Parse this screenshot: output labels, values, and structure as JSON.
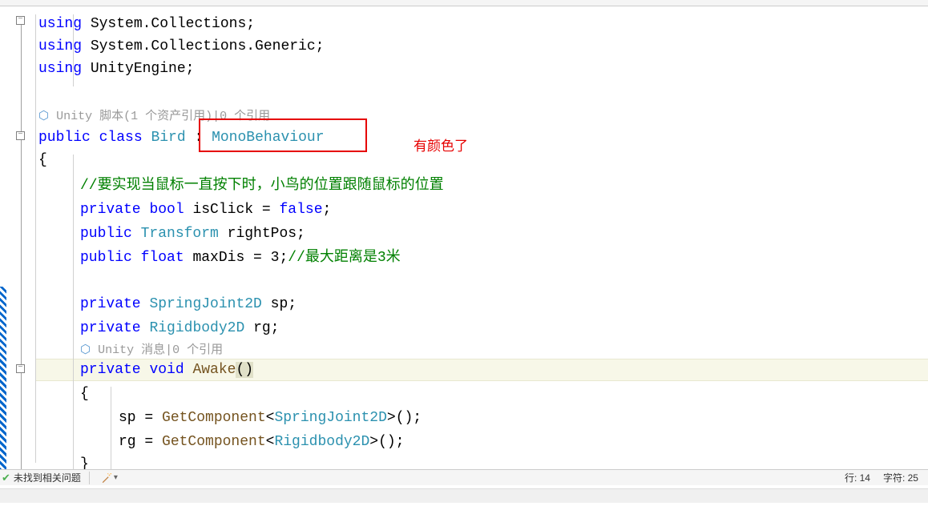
{
  "code": {
    "line1": "using",
    "line1_ns": " System.Collections;",
    "line2": "using",
    "line2_ns": " System.Collections.Generic;",
    "line3": "using",
    "line3_ns": " UnityEngine;",
    "codelens1": " Unity 脚本(1 个资产引用)|0 个引用",
    "line5_kw1": "public",
    "line5_kw2": "class",
    "line5_cls": "Bird",
    "line5_colon": " : ",
    "line5_base": "MonoBehaviour",
    "brace_open": "{",
    "comment1": "//要实现当鼠标一直按下时，小鸟的位置跟随鼠标的位置",
    "line8_kw": "private",
    "line8_type": "bool",
    "line8_rest": " isClick = ",
    "line8_false": "false",
    "line8_semi": ";",
    "line9_kw": "public",
    "line9_type": "Transform",
    "line9_rest": " rightPos;",
    "line10_kw": "public",
    "line10_type": "float",
    "line10_rest": " maxDis = 3;",
    "line10_comment": "//最大距离是3米",
    "line12_kw": "private",
    "line12_type": "SpringJoint2D",
    "line12_rest": " sp;",
    "line13_kw": "private",
    "line13_type": "Rigidbody2D",
    "line13_rest": " rg;",
    "codelens2": " Unity 消息|0 个引用",
    "line14_kw": "private",
    "line14_void": "void",
    "line14_method": " Awake",
    "line14_paren": "()",
    "brace_open2": "{",
    "line16_lhs": "sp = ",
    "line16_method": "GetComponent",
    "line16_lt": "<",
    "line16_type": "SpringJoint2D",
    "line16_gt": ">();",
    "line17_lhs": "rg = ",
    "line17_method": "GetComponent",
    "line17_lt": "<",
    "line17_type": "Rigidbody2D",
    "line17_gt": ">();",
    "brace_close": "}"
  },
  "annotation": {
    "text": "有颜色了"
  },
  "status": {
    "no_issues": "未找到相关问题",
    "line_label": "行: 14",
    "char_label": "字符: 25"
  },
  "codelens_icon": "⬡"
}
